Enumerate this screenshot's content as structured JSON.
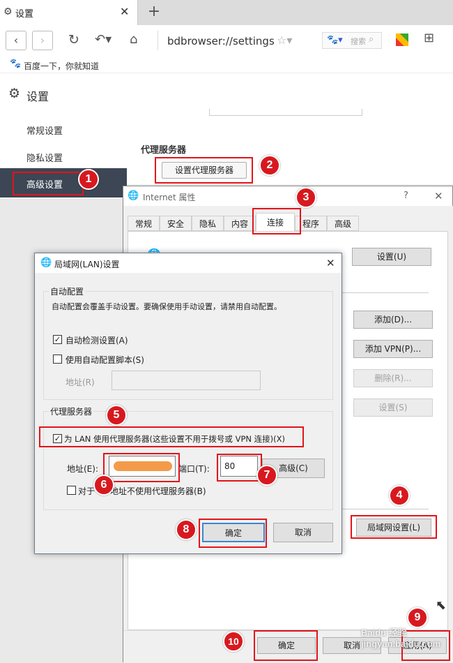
{
  "browser": {
    "tab_title": "设置",
    "url": "bdbrowser://settings",
    "bookmark": "百度一下，你就知道",
    "search_placeholder": "搜索"
  },
  "settings": {
    "title": "设置",
    "sidebar": [
      {
        "label": "常规设置"
      },
      {
        "label": "隐私设置"
      },
      {
        "label": "高级设置"
      }
    ],
    "proxy_section_title": "代理服务器",
    "proxy_button": "设置代理服务器"
  },
  "internet_props": {
    "title": "Internet 属性",
    "help": "?",
    "tabs": [
      "常规",
      "安全",
      "隐私",
      "内容",
      "连接",
      "程序",
      "高级"
    ],
    "buttons": {
      "setup": "设置(U)",
      "add": "添加(D)...",
      "add_vpn": "添加 VPN(P)...",
      "remove": "删除(R)...",
      "settings": "设置(S)",
      "lan": "局域网设置(L)",
      "ok": "确定",
      "cancel": "取消",
      "apply": "应用(A)"
    }
  },
  "lan_dialog": {
    "title": "局域网(LAN)设置",
    "auto_group": "自动配置",
    "auto_desc": "自动配置会覆盖手动设置。要确保使用手动设置，请禁用自动配置。",
    "auto_detect": "自动检测设置(A)",
    "auto_detect_checked": true,
    "use_script": "使用自动配置脚本(S)",
    "use_script_checked": false,
    "address_label": "地址(R)",
    "proxy_group": "代理服务器",
    "use_proxy": "为 LAN 使用代理服务器(这些设置不用于拨号或 VPN 连接)(X)",
    "use_proxy_checked": true,
    "proxy_address_label": "地址(E):",
    "port_label": "端口(T):",
    "port_value": "80",
    "advanced": "高级(C)",
    "bypass_prefix": "对于",
    "bypass_suffix": "地址不使用代理服务器(B)",
    "bypass_checked": false,
    "ok": "确定",
    "cancel": "取消"
  },
  "badges": [
    "1",
    "2",
    "3",
    "4",
    "5",
    "6",
    "7",
    "8",
    "9",
    "10"
  ],
  "watermark": "Baidu 经验 jingyan.baidu.com",
  "colors": {
    "annotation_red": "#e2141a",
    "sidebar_active": "#3c4654",
    "redacted_orange": "#f39b4a"
  }
}
